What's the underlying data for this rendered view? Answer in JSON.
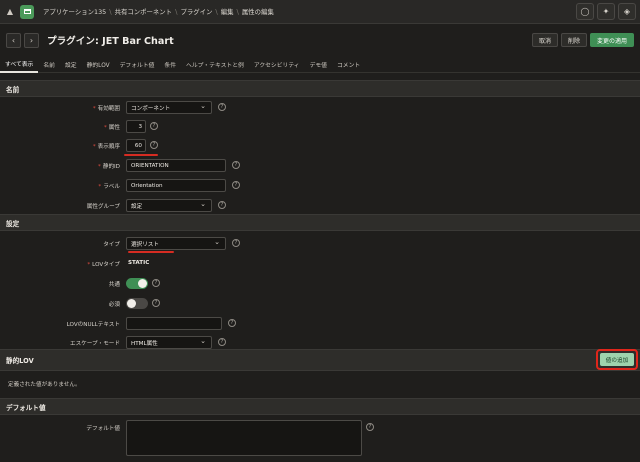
{
  "breadcrumb": {
    "items": [
      "アプリケーション135",
      "共有コンポーネント",
      "プラグイン",
      "編集",
      "属性の編集"
    ]
  },
  "header": {
    "title": "プラグイン: JET Bar Chart",
    "cancel_label": "取消",
    "delete_label": "削除",
    "apply_label": "変更の適用"
  },
  "tabs": [
    "すべて表示",
    "名前",
    "設定",
    "静的LOV",
    "デフォルト値",
    "条件",
    "ヘルプ・テキストと例",
    "アクセシビリティ",
    "デモ値",
    "コメント"
  ],
  "sections": {
    "name": "名前",
    "settings": "設定",
    "static_lov": "静的LOV",
    "default_value": "デフォルト値"
  },
  "name_section": {
    "scope_label": "有効範囲",
    "scope_value": "コンポーネント",
    "attribute_label": "属性",
    "attribute_value": "3",
    "display_seq_label": "表示順序",
    "display_seq_value": "60",
    "static_id_label": "静的ID",
    "static_id_value": "ORIENTATION",
    "label_label": "ラベル",
    "label_value": "Orientation",
    "attr_group_label": "属性グループ",
    "attr_group_value": "設定"
  },
  "settings_section": {
    "type_label": "タイプ",
    "type_value": "選択リスト",
    "lov_type_label": "LOVタイプ",
    "lov_type_value": "STATIC",
    "common_label": "共通",
    "common_on": true,
    "required_label": "必須",
    "required_on": false,
    "null_text_label": "LOVのNULLテキスト",
    "null_text_value": "",
    "escape_label": "エスケープ・モード",
    "escape_value": "HTML属性"
  },
  "static_lov": {
    "add_button": "値の追加",
    "empty_text": "定義された値がありません。"
  },
  "default_section": {
    "default_label": "デフォルト値",
    "default_value": ""
  },
  "icons": {
    "up": "up-arrow-icon",
    "app": "app-icon",
    "help": "help-icon"
  },
  "colors": {
    "accent": "#3f8f55",
    "highlight": "#d62c22",
    "add_button": "#9fd3ad"
  }
}
